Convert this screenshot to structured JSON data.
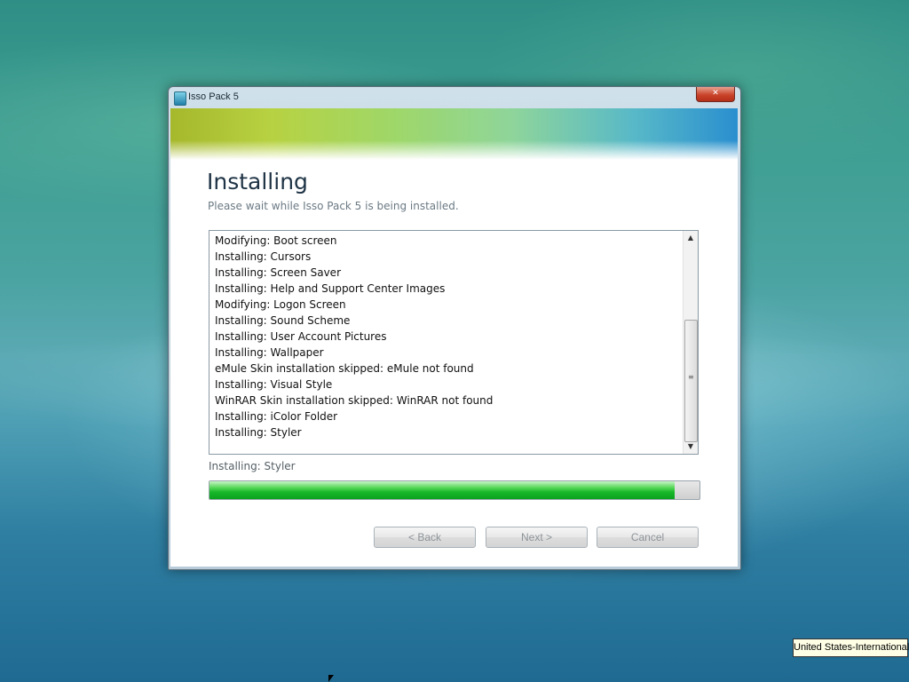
{
  "window": {
    "title": "Isso Pack 5",
    "close_glyph": "✕"
  },
  "header": {
    "title": "Installing",
    "subtitle": "Please wait while Isso Pack 5 is being installed."
  },
  "log": {
    "items": [
      "Modifying: Boot screen",
      "Installing: Cursors",
      "Installing: Screen Saver",
      "Installing: Help and Support Center Images",
      "Modifying: Logon Screen",
      "Installing: Sound Scheme",
      "Installing: User Account Pictures",
      "Installing: Wallpaper",
      "eMule Skin installation skipped: eMule not found",
      "Installing: Visual Style",
      "WinRAR Skin installation skipped: WinRAR not found",
      "Installing: iColor Folder",
      "Installing: Styler"
    ]
  },
  "status": {
    "text": "Installing: Styler"
  },
  "progress": {
    "value_percent": 95,
    "color": "#19b82a"
  },
  "buttons": {
    "back": "< Back",
    "next": "Next >",
    "cancel": "Cancel"
  },
  "taskbar": {
    "language": "United States-International"
  }
}
